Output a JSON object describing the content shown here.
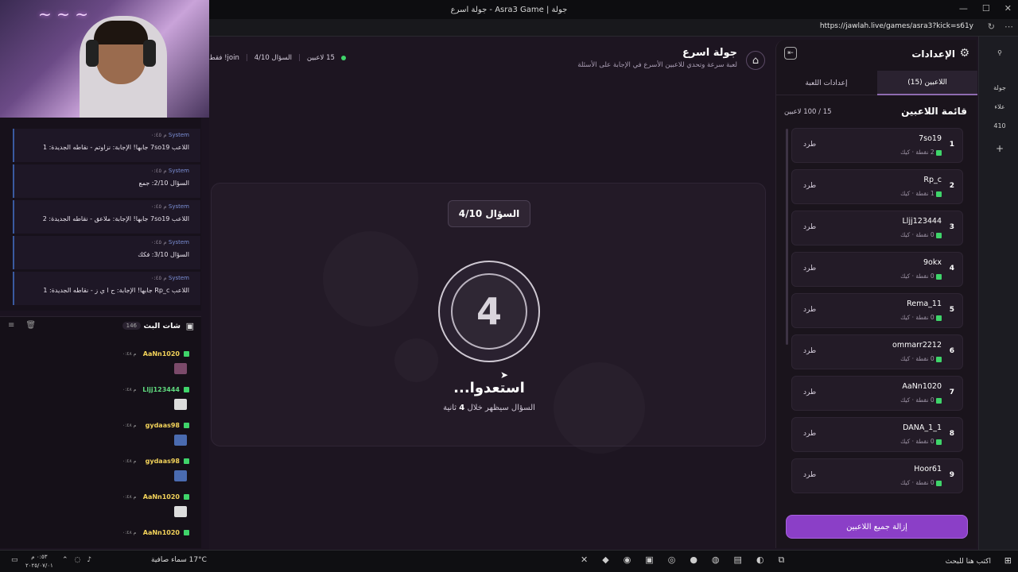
{
  "browser": {
    "title": "جولة اسرع - Asra3 Game | جولة",
    "url": "https://jawlah.live/games/asra3?kick=s61y"
  },
  "game": {
    "title": "جولة اسرع",
    "subtitle": "لعبة سرعة وتحدي للاعبين الأسرع في الإجابة على الأسئلة",
    "players_online": "15 لاعبين",
    "question_progress": "السؤال 4/10",
    "join_hint": "join! فقط"
  },
  "center": {
    "question_badge": "السؤال 4/10",
    "countdown": "4",
    "ready_text": "استعدوا...",
    "appear_text": "السؤال سيظهر خلال",
    "appear_seconds": "4",
    "appear_unit": "ثانية"
  },
  "panel": {
    "title": "الإعدادات",
    "tabs": [
      {
        "label": "اللاعبين (15)",
        "active": true
      },
      {
        "label": "إعدادات اللعبة",
        "active": false
      }
    ],
    "list_title": "قائمة اللاعبين",
    "list_count": "15 / 100 لاعبين",
    "kick_label": "طرد",
    "remove_all": "إزالة جميع اللاعبين",
    "players": [
      {
        "rank": "1",
        "name": "7so19",
        "meta": "2 نقطة · كيك"
      },
      {
        "rank": "2",
        "name": "Rp_c",
        "meta": "1 نقطة · كيك"
      },
      {
        "rank": "3",
        "name": "Lljj123444",
        "meta": "0 نقطة · كيك"
      },
      {
        "rank": "4",
        "name": "9okx",
        "meta": "0 نقطة · كيك"
      },
      {
        "rank": "5",
        "name": "Rema_11",
        "meta": "0 نقطة · كيك"
      },
      {
        "rank": "6",
        "name": "ommarr2212",
        "meta": "0 نقطة · كيك"
      },
      {
        "rank": "7",
        "name": "AaNn1020",
        "meta": "0 نقطة · كيك"
      },
      {
        "rank": "8",
        "name": "DANA_1_1",
        "meta": "0 نقطة · كيك"
      },
      {
        "rank": "9",
        "name": "Hoor61",
        "meta": "0 نقطة · كيك"
      }
    ]
  },
  "system_chat": [
    {
      "who": "System",
      "time": "م ٠:٤٥",
      "text": "اللاعب 7so19 جابها! الإجابة: نزاوتم - نقاطه الجديدة: 1"
    },
    {
      "who": "System",
      "time": "م ٠:٤٥",
      "text": "السؤال 2/10: جمع"
    },
    {
      "who": "System",
      "time": "م ٠:٤٥",
      "text": "اللاعب 7so19 جابها! الإجابة: ملاعق - نقاطه الجديدة: 2"
    },
    {
      "who": "System",
      "time": "م ٠:٤٥",
      "text": "السؤال 3/10: فكك"
    },
    {
      "who": "System",
      "time": "م ٠:٤٥",
      "text": "اللاعب Rp_c جابها! الإجابة: ح ا ي ز - نقاطه الجديدة: 1"
    }
  ],
  "live_chat": {
    "title": "شات البث",
    "count": "146",
    "messages": [
      {
        "user": "AaNn1020",
        "time": "م ٠:٤٨"
      },
      {
        "user": "Lljj123444",
        "time": "م ٠:٤٨"
      },
      {
        "user": "gydaas98",
        "time": "م ٠:٤٨"
      },
      {
        "user": "gydaas98",
        "time": "م ٠:٤٨"
      },
      {
        "user": "AaNn1020",
        "time": "م ٠:٤٨"
      },
      {
        "user": "AaNn1020",
        "time": "م ٠:٤٨"
      }
    ]
  },
  "taskbar": {
    "search": "اكتب هنا للبحث",
    "weather": "17°C  سماء صافية",
    "time": "٠:٥٣ م",
    "date": "٢٠٢٥/٠٧/٠١"
  },
  "edge_sidebar": [
    "علاء",
    "410"
  ]
}
